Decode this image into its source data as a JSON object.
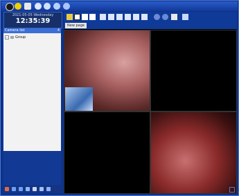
{
  "header": {
    "date": "2021-05-05 Wednesday",
    "time": "12:35:39"
  },
  "camera_list": {
    "title": "Camera list",
    "pin": "4",
    "groups": [
      {
        "expand": "+",
        "label": "Group"
      }
    ]
  },
  "tabs": [
    {
      "label": "New page"
    }
  ],
  "colors": {
    "frame": "#0d3186",
    "toolbar": "#0f3a98",
    "accent": "#3b6fd6",
    "video_bg": "#000000"
  },
  "top_icons": [
    "camera-icon",
    "disc-icon",
    "document-icon",
    "play-icon",
    "refresh-icon",
    "settings-icon",
    "network-icon"
  ],
  "layout_icons": [
    "single-layout-icon",
    "quad-layout-icon",
    "nine-layout-icon",
    "sixteen-layout-icon",
    "custom-layout-1-icon",
    "custom-layout-2-icon",
    "custom-layout-3-icon",
    "custom-layout-4-icon",
    "fullscreen-icon",
    "close-all-icon",
    "record-icon",
    "snapshot-icon",
    "grid-config-icon",
    "more-layout-icon"
  ]
}
